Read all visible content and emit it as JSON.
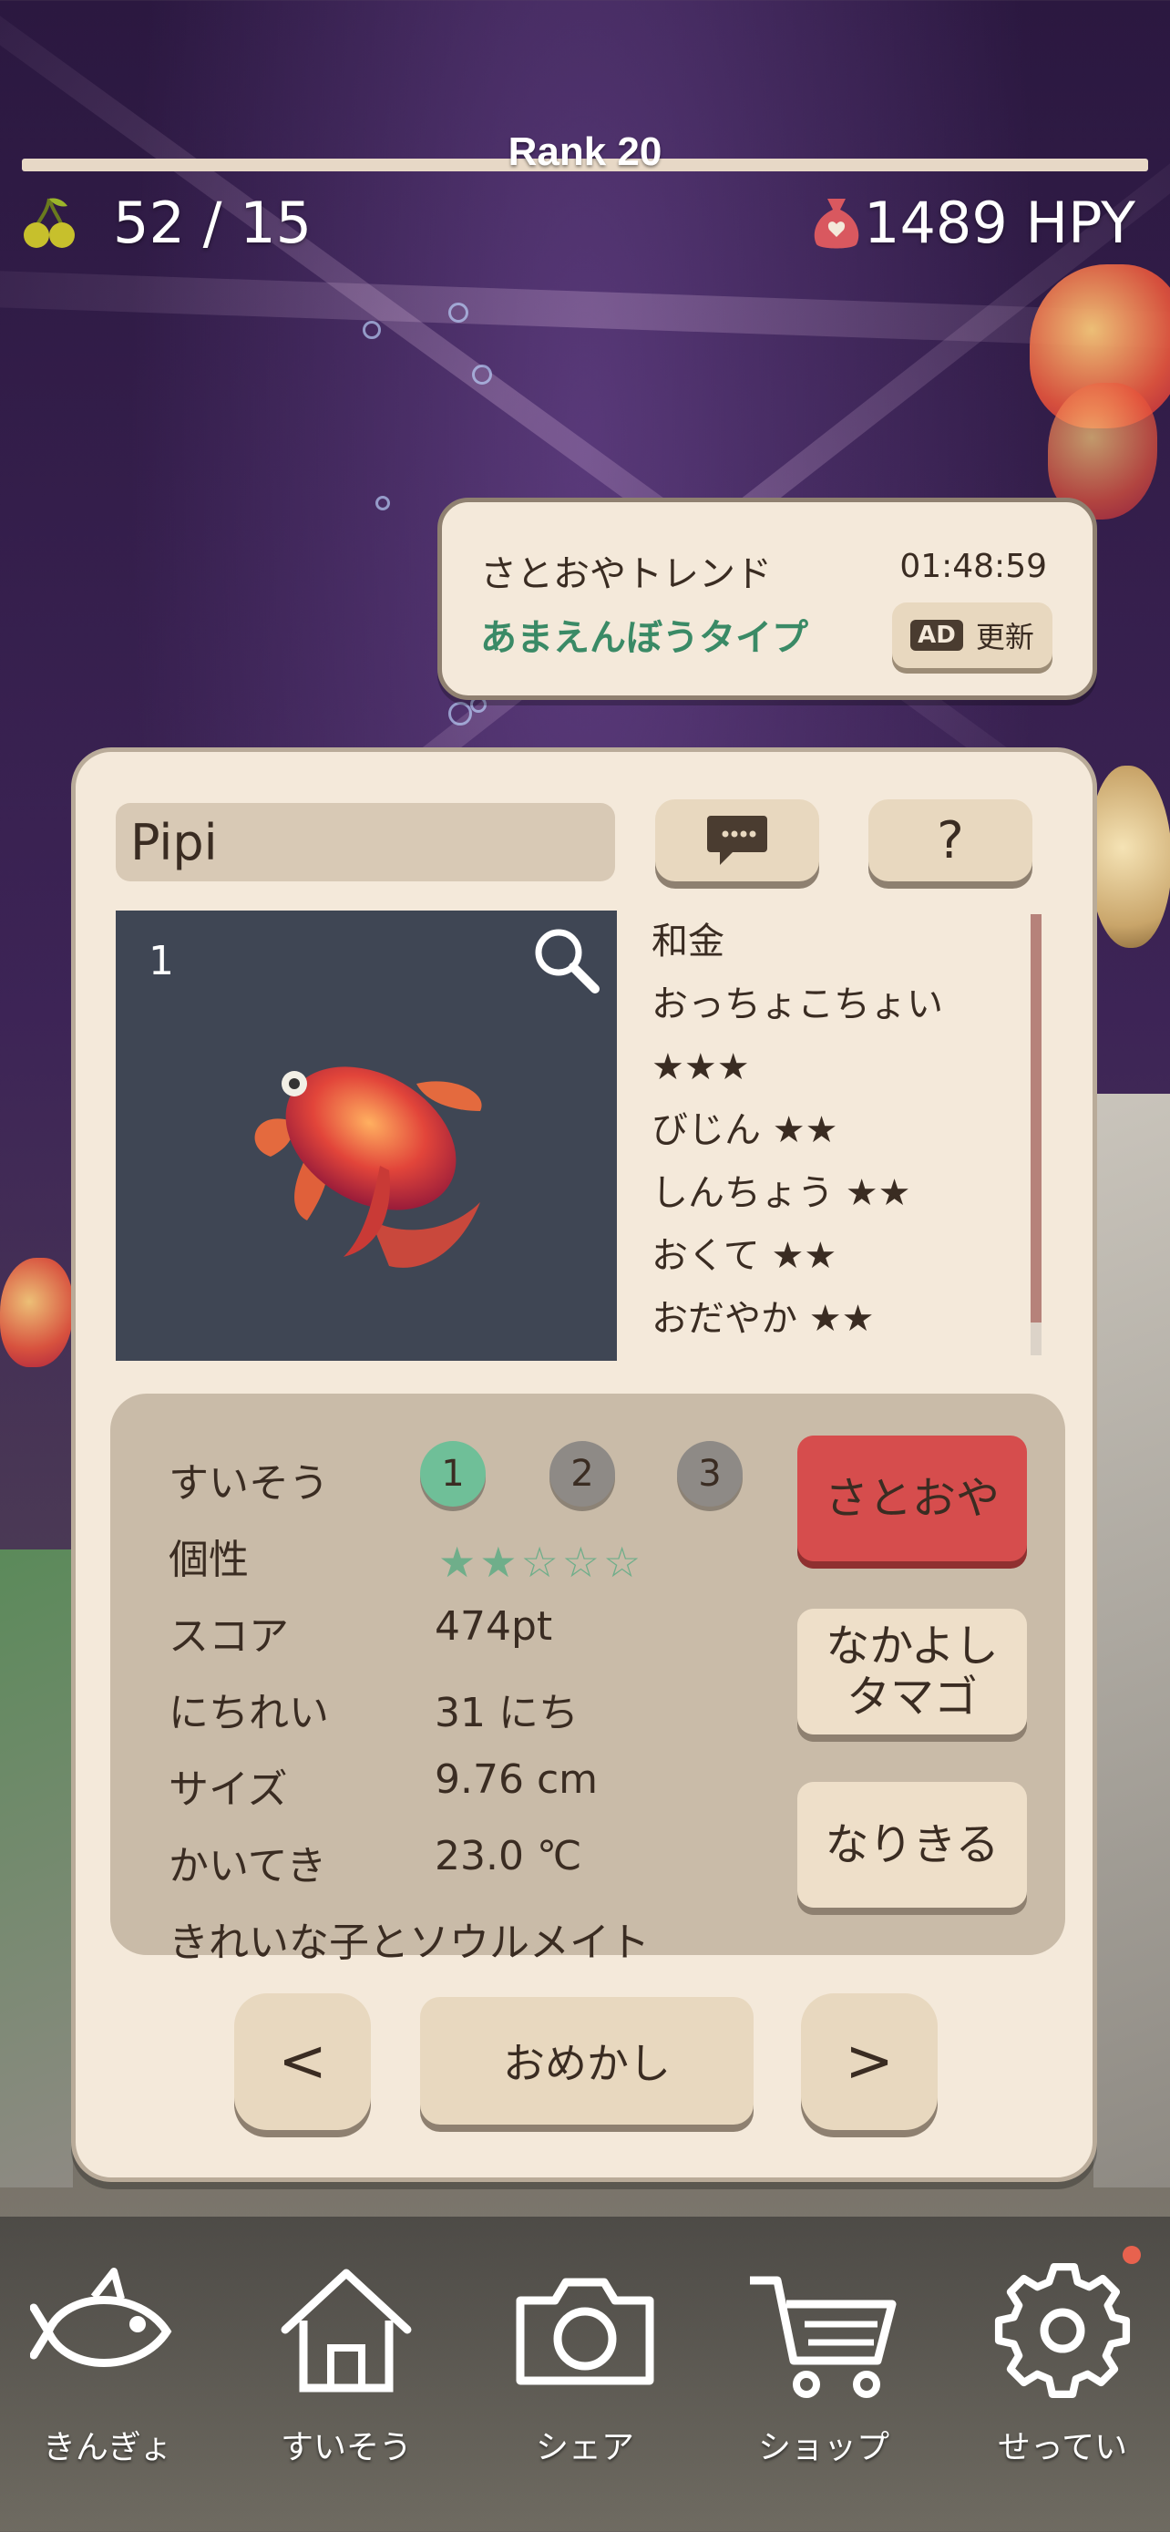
{
  "top": {
    "rank": "Rank 20",
    "food": "52 / 15",
    "currency": "1489  HPY"
  },
  "trend": {
    "title": "さとおやトレンド",
    "timer": "01:48:59",
    "type": "あまえんぼうタイプ",
    "ad_badge": "AD",
    "refresh_label": "更新"
  },
  "fish": {
    "name": "Pipi",
    "photo_index": "1",
    "help_label": "?",
    "traits": [
      "和金",
      "おっちょこちょい",
      "★★★",
      "びじん ★★",
      "しんちょう ★★",
      "おくて ★★",
      "おだやか ★★"
    ]
  },
  "info": {
    "tank_label": "すいそう",
    "tanks": [
      "1",
      "2",
      "3"
    ],
    "active_tank": "1",
    "personality_label": "個性",
    "personality_stars": "★★☆☆☆",
    "personality_rating": 2,
    "score_label": "スコア",
    "score_value": "474pt",
    "age_label": "にちれい",
    "age_value": "31 にち",
    "size_label": "サイズ",
    "size_value": "9.76 cm",
    "comfort_label": "かいてき",
    "comfort_value": "23.0 ℃",
    "soulmate": "きれいな子とソウルメイト"
  },
  "actions": {
    "satooya": "さとおや",
    "nakayoshi_line1": "なかよし",
    "nakayoshi_line2": "タマゴ",
    "narikiru": "なりきる",
    "prev": "<",
    "omekashi": "おめかし",
    "next": ">"
  },
  "nav": [
    {
      "label": "きんぎょ",
      "icon": "goldfish-icon"
    },
    {
      "label": "すいそう",
      "icon": "home-icon"
    },
    {
      "label": "シェア",
      "icon": "camera-icon"
    },
    {
      "label": "ショップ",
      "icon": "cart-icon"
    },
    {
      "label": "せってい",
      "icon": "gear-icon"
    }
  ],
  "colors": {
    "panel": "#f4e9da",
    "accent_green": "#3a8a66",
    "satooya_red": "#d64d4d",
    "scroll_thumb": "#b6827a"
  }
}
